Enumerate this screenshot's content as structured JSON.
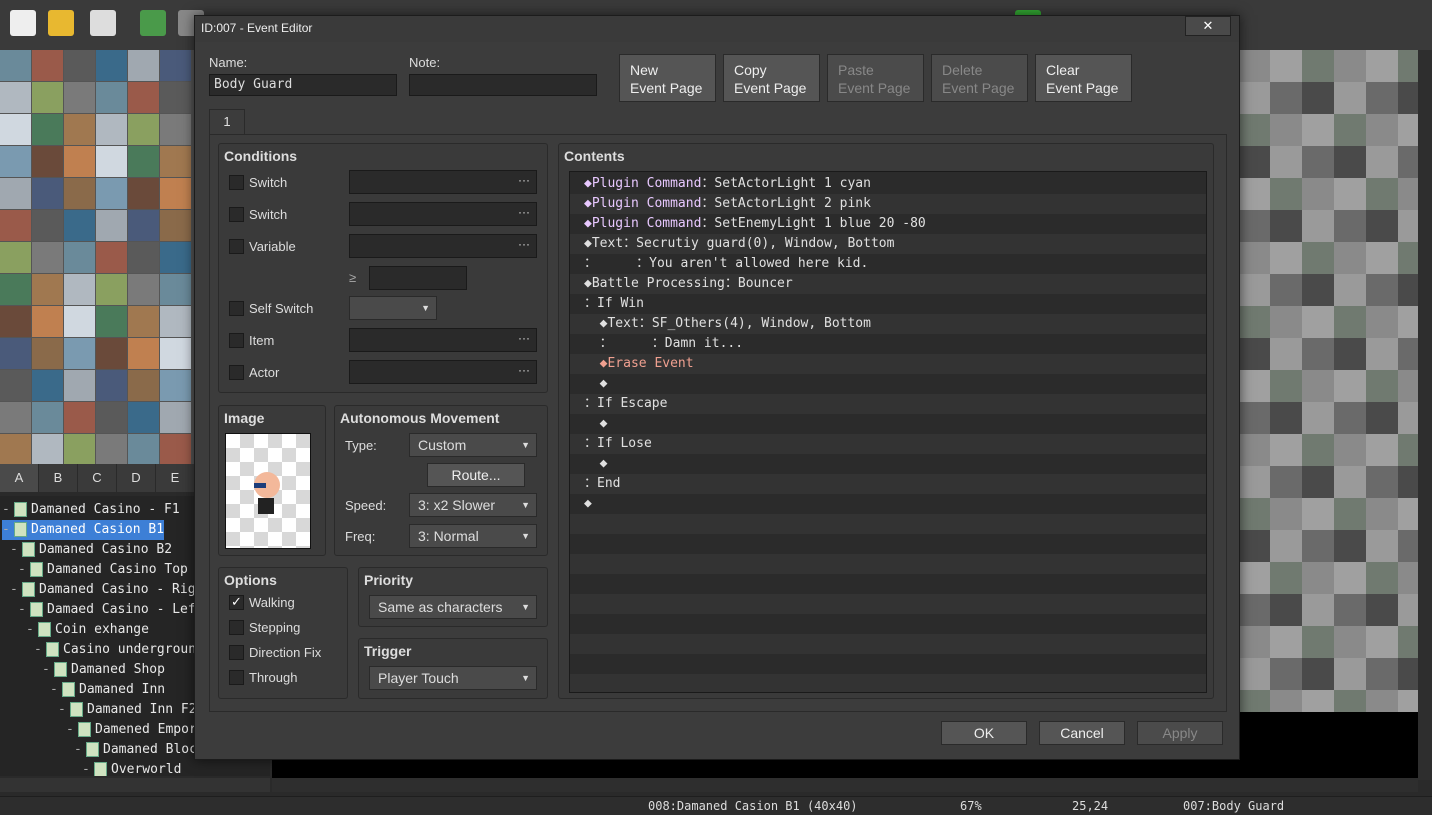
{
  "dialog": {
    "title": "ID:007 - Event Editor",
    "close": "✕",
    "name_label": "Name:",
    "name_value": "Body Guard",
    "note_label": "Note:",
    "note_value": "",
    "page_tab": "1",
    "buttons": {
      "new_page": [
        "New",
        "Event Page"
      ],
      "copy_page": [
        "Copy",
        "Event Page"
      ],
      "paste_page": [
        "Paste",
        "Event Page"
      ],
      "delete_page": [
        "Delete",
        "Event Page"
      ],
      "clear_page": [
        "Clear",
        "Event Page"
      ]
    },
    "conditions": {
      "title": "Conditions",
      "switch1": "Switch",
      "switch2": "Switch",
      "variable": "Variable",
      "gte": "≥",
      "self_switch": "Self Switch",
      "item": "Item",
      "actor": "Actor",
      "dots": "···"
    },
    "image": {
      "title": "Image"
    },
    "movement": {
      "title": "Autonomous Movement",
      "type_label": "Type:",
      "type_value": "Custom",
      "route_button": "Route...",
      "speed_label": "Speed:",
      "speed_value": "3: x2 Slower",
      "freq_label": "Freq:",
      "freq_value": "3: Normal"
    },
    "options": {
      "title": "Options",
      "walking": "Walking",
      "stepping": "Stepping",
      "direction_fix": "Direction Fix",
      "through": "Through",
      "walking_checked": "✓"
    },
    "priority": {
      "title": "Priority",
      "value": "Same as characters"
    },
    "trigger": {
      "title": "Trigger",
      "value": "Player Touch"
    },
    "contents": {
      "title": "Contents",
      "lines": [
        {
          "head": "◆Plugin Command",
          "sep": "：",
          "body": "SetActorLight 1 cyan"
        },
        {
          "head": "◆Plugin Command",
          "sep": "：",
          "body": "SetActorLight 2 pink"
        },
        {
          "head": "◆Plugin Command",
          "sep": "：",
          "body": "SetEnemyLight 1 blue 20 -80"
        },
        {
          "head": "◆Text",
          "sep": "：",
          "body": "Secrutiy guard(0), Window, Bottom"
        },
        {
          "head": "：",
          "sep": "     ：",
          "body": "You aren't allowed here kid."
        },
        {
          "head": "◆Battle Processing",
          "sep": "：",
          "body": "Bouncer"
        },
        {
          "head": "：If Win",
          "sep": "",
          "body": ""
        },
        {
          "head": "  ◆Text",
          "sep": "：",
          "body": "SF_Others(4), Window, Bottom"
        },
        {
          "head": "  ：",
          "sep": "     ：",
          "body": "Damn it..."
        },
        {
          "head": "  ◆Erase Event",
          "sep": "",
          "body": ""
        },
        {
          "head": "  ◆",
          "sep": "",
          "body": ""
        },
        {
          "head": "：If Escape",
          "sep": "",
          "body": ""
        },
        {
          "head": "  ◆",
          "sep": "",
          "body": ""
        },
        {
          "head": "：If Lose",
          "sep": "",
          "body": ""
        },
        {
          "head": "  ◆",
          "sep": "",
          "body": ""
        },
        {
          "head": "：End",
          "sep": "",
          "body": ""
        },
        {
          "head": "◆",
          "sep": "",
          "body": ""
        }
      ]
    },
    "ok": "OK",
    "cancel": "Cancel",
    "apply": "Apply"
  },
  "tileset_tabs": [
    "A",
    "B",
    "C",
    "D",
    "E"
  ],
  "map_tree": [
    {
      "label": "Damaned Casino  - F1",
      "indent": 0,
      "sel": false
    },
    {
      "label": "Damaned Casion B1",
      "indent": 0,
      "sel": true
    },
    {
      "label": "Damaned Casino B2",
      "indent": 1,
      "sel": false
    },
    {
      "label": "Damaned Casino Top Fl",
      "indent": 2,
      "sel": false
    },
    {
      "label": "Damaned Casino - Right",
      "indent": 1,
      "sel": false
    },
    {
      "label": "Damaed Casino - Left",
      "indent": 2,
      "sel": false
    },
    {
      "label": "Coin exhange",
      "indent": 3,
      "sel": false
    },
    {
      "label": "Casino underground",
      "indent": 4,
      "sel": false
    },
    {
      "label": "Damaned Shop",
      "indent": 5,
      "sel": false
    },
    {
      "label": "Damaned Inn",
      "indent": 6,
      "sel": false
    },
    {
      "label": "Damaned Inn F2",
      "indent": 7,
      "sel": false
    },
    {
      "label": "Damened Empori",
      "indent": 8,
      "sel": false
    },
    {
      "label": "Damaned Block",
      "indent": 9,
      "sel": false
    },
    {
      "label": "Overworld",
      "indent": 10,
      "sel": false
    }
  ],
  "status": {
    "map": "008:Damaned Casion B1 (40x40)",
    "zoom": "67%",
    "coords": "25,24",
    "event": "007:Body Guard"
  },
  "colors": {
    "accent": "#3d7fd6",
    "plugin": "#e8c8ff",
    "erase": "#f0a090"
  }
}
